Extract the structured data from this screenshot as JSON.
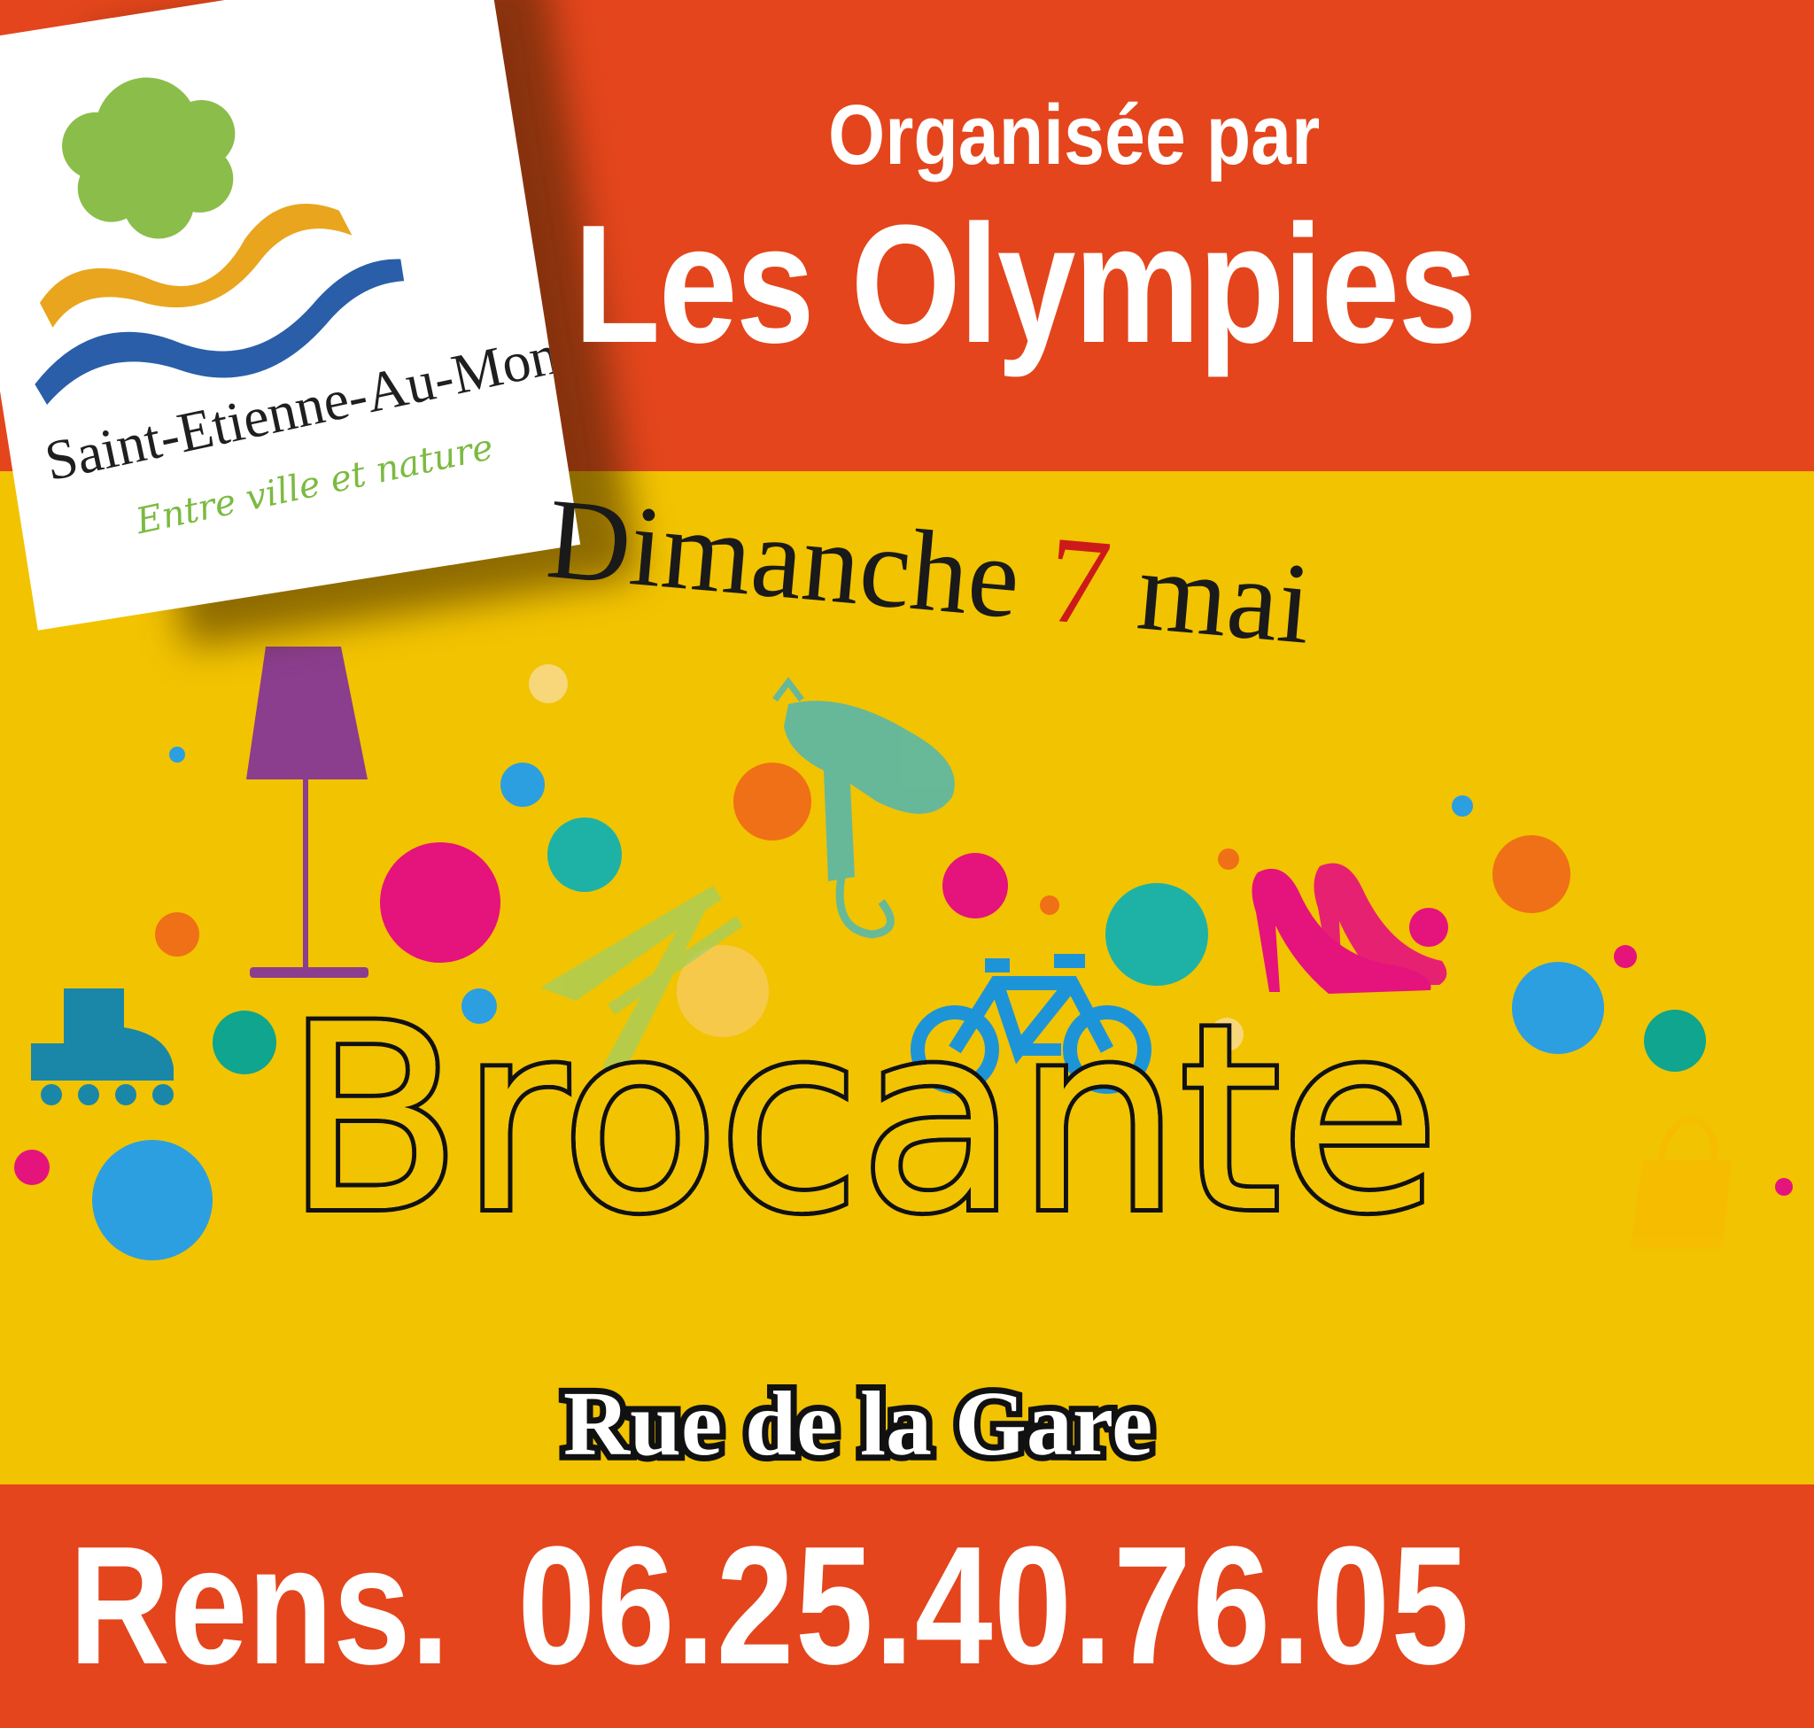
{
  "logo": {
    "town": "Saint-Etienne-Au-Mont",
    "tagline": "Entre ville et nature"
  },
  "header": {
    "organised_by": "Organisée par",
    "organiser": "Les Olympies"
  },
  "date": {
    "day": "Dimanche",
    "number": "7",
    "month": "mai"
  },
  "event": {
    "title": "Brocante",
    "location": "Rue de la Gare"
  },
  "contact": {
    "prefix": "Rens.",
    "phone": "06.25.40.76.05"
  },
  "colors": {
    "orange_band": "#e4451c",
    "yellow_background": "#f2c300",
    "date_number": "#cc1a1a"
  }
}
